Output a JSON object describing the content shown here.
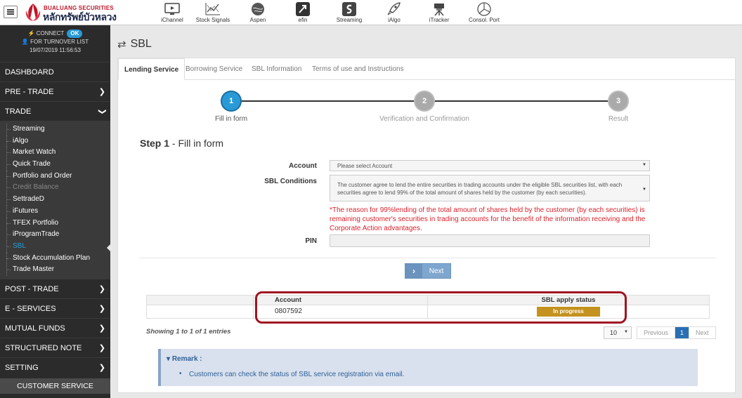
{
  "brand": {
    "name_en": "BUALUANG SECURITIES",
    "name_th": "หลักทรัพย์บัวหลวง"
  },
  "apps": [
    {
      "label": "iChannel",
      "icon": "monitor-icon"
    },
    {
      "label": "Stock Signals",
      "icon": "signals-icon"
    },
    {
      "label": "Aspen",
      "icon": "globe-icon"
    },
    {
      "label": "efin",
      "icon": "efin-icon"
    },
    {
      "label": "Streaming",
      "icon": "streaming-icon"
    },
    {
      "label": "iAlgo",
      "icon": "rocket-icon"
    },
    {
      "label": "iTracker",
      "icon": "tracker-icon"
    },
    {
      "label": "Consol. Port",
      "icon": "pie-icon"
    }
  ],
  "connection": {
    "label": "CONNECT",
    "status": "OK",
    "turnover": "FOR TURNOVER LIST",
    "datetime": "19/07/2019 11:56:53"
  },
  "sidebar": {
    "top": [
      {
        "label": "DASHBOARD"
      },
      {
        "label": "PRE - TRADE"
      },
      {
        "label": "TRADE"
      }
    ],
    "trade_items": [
      {
        "label": "Streaming"
      },
      {
        "label": "iAlgo"
      },
      {
        "label": "Market Watch"
      },
      {
        "label": "Quick Trade"
      },
      {
        "label": "Portfolio and Order"
      },
      {
        "label": "Credit Balance"
      },
      {
        "label": "SettradeD"
      },
      {
        "label": "iFutures"
      },
      {
        "label": "TFEX Portfolio"
      },
      {
        "label": "iProgramTrade"
      },
      {
        "label": "SBL"
      },
      {
        "label": "Stock Accumulation Plan"
      },
      {
        "label": "Trade Master"
      }
    ],
    "bottom": [
      {
        "label": "POST - TRADE"
      },
      {
        "label": "E - SERVICES"
      },
      {
        "label": "MUTUAL FUNDS"
      },
      {
        "label": "STRUCTURED NOTE"
      },
      {
        "label": "SETTING"
      }
    ],
    "customer_service": "CUSTOMER SERVICE"
  },
  "page": {
    "title": "SBL",
    "tabs": [
      "Lending Service",
      "Borrowing Service",
      "SBL Information",
      "Terms of use and Instructions"
    ]
  },
  "stepper": [
    {
      "num": "1",
      "label": "Fill in form"
    },
    {
      "num": "2",
      "label": "Verification and Confirmation"
    },
    {
      "num": "3",
      "label": "Result"
    }
  ],
  "form": {
    "step_bold": "Step 1",
    "step_rest": " - Fill in form",
    "account_label": "Account",
    "account_placeholder": "Please select Account",
    "conditions_label": "SBL Conditions",
    "conditions_text": "The customer agree to lend the entire securities in trading accounts under the eligible SBL securities list, with each securities agree to lend 99% of the total amount of shares held by the customer (by each securities).",
    "notice": "*The reason for 99%lending of the total amount of shares held by the customer (by each securities) is remaining customer's securities in trading accounts for the benefit of the information receiving and the Corporate Action advantages.",
    "pin_label": "PIN",
    "next_label": "Next"
  },
  "table": {
    "headers": [
      "Account",
      "SBL apply status"
    ],
    "rows": [
      {
        "account": "0807592",
        "status": "In progress"
      }
    ],
    "entries": "Showing 1 to 1 of 1 entries",
    "page_size": "10",
    "prev": "Previous",
    "current_page": "1",
    "next": "Next"
  },
  "remark": {
    "title": "Remark :",
    "item": "Customers can check the status of SBL service registration via email."
  },
  "colors": {
    "accent": "#2a9ad6",
    "sidebar_bg": "#2b2b2b",
    "notice_red": "#d9232d",
    "status_gold": "#c4921e",
    "highlight": "#a01423"
  }
}
